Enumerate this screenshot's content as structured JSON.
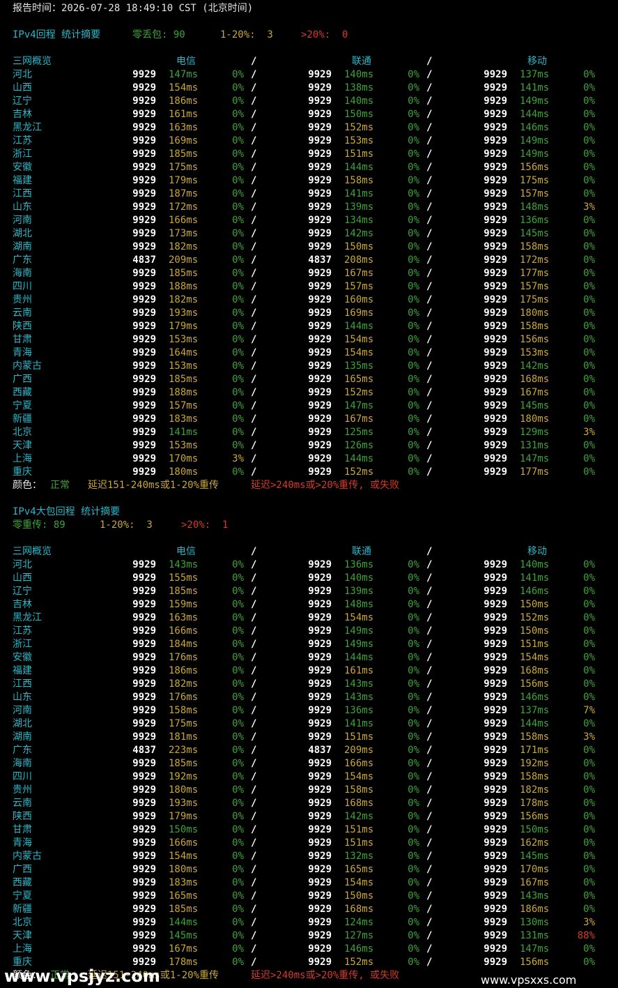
{
  "header": {
    "report_time": "报告时间：2026-07-28 18:49:10 CST (北京时间)"
  },
  "legend": {
    "label": "颜色：",
    "normal": "正常",
    "warn": "延迟151-240ms或1-20%重传",
    "bad": "延迟>240ms或>20%重传, 或失败"
  },
  "colors": {
    "green": "#3fa23a",
    "yellow": "#c8a83a",
    "red": "#d43c2c",
    "cyan": "#2ab7c9"
  },
  "columns": {
    "overview": "三网概览",
    "telecom": "电信",
    "unicom": "联通",
    "mobile": "移动",
    "sep": "/"
  },
  "sections": [
    {
      "title": "IPv4回程 统计摘要",
      "summary": [
        {
          "text": "零丢包: 90",
          "cls": "g"
        },
        {
          "text": "1-20%:  3",
          "cls": "y"
        },
        {
          "text": ">20%:  0",
          "cls": "r"
        }
      ],
      "rows": [
        [
          "河北",
          "9929",
          "147ms",
          "g",
          "0%",
          "g",
          "9929",
          "140ms",
          "g",
          "0%",
          "g",
          "9929",
          "137ms",
          "g",
          "0%",
          "g"
        ],
        [
          "山西",
          "9929",
          "154ms",
          "y",
          "0%",
          "g",
          "9929",
          "138ms",
          "g",
          "0%",
          "g",
          "9929",
          "141ms",
          "g",
          "0%",
          "g"
        ],
        [
          "辽宁",
          "9929",
          "186ms",
          "y",
          "0%",
          "g",
          "9929",
          "140ms",
          "g",
          "0%",
          "g",
          "9929",
          "149ms",
          "g",
          "0%",
          "g"
        ],
        [
          "吉林",
          "9929",
          "161ms",
          "y",
          "0%",
          "g",
          "9929",
          "150ms",
          "g",
          "0%",
          "g",
          "9929",
          "144ms",
          "g",
          "0%",
          "g"
        ],
        [
          "黑龙江",
          "9929",
          "163ms",
          "y",
          "0%",
          "g",
          "9929",
          "152ms",
          "y",
          "0%",
          "g",
          "9929",
          "146ms",
          "g",
          "0%",
          "g"
        ],
        [
          "江苏",
          "9929",
          "169ms",
          "y",
          "0%",
          "g",
          "9929",
          "153ms",
          "y",
          "0%",
          "g",
          "9929",
          "149ms",
          "g",
          "0%",
          "g"
        ],
        [
          "浙江",
          "9929",
          "185ms",
          "y",
          "0%",
          "g",
          "9929",
          "151ms",
          "y",
          "0%",
          "g",
          "9929",
          "149ms",
          "g",
          "0%",
          "g"
        ],
        [
          "安徽",
          "9929",
          "175ms",
          "y",
          "0%",
          "g",
          "9929",
          "144ms",
          "g",
          "0%",
          "g",
          "9929",
          "156ms",
          "y",
          "0%",
          "g"
        ],
        [
          "福建",
          "9929",
          "179ms",
          "y",
          "0%",
          "g",
          "9929",
          "158ms",
          "y",
          "0%",
          "g",
          "9929",
          "175ms",
          "y",
          "0%",
          "g"
        ],
        [
          "江西",
          "9929",
          "187ms",
          "y",
          "0%",
          "g",
          "9929",
          "141ms",
          "g",
          "0%",
          "g",
          "9929",
          "157ms",
          "y",
          "0%",
          "g"
        ],
        [
          "山东",
          "9929",
          "172ms",
          "y",
          "0%",
          "g",
          "9929",
          "139ms",
          "g",
          "0%",
          "g",
          "9929",
          "148ms",
          "g",
          "3%",
          "y"
        ],
        [
          "河南",
          "9929",
          "166ms",
          "y",
          "0%",
          "g",
          "9929",
          "134ms",
          "g",
          "0%",
          "g",
          "9929",
          "136ms",
          "g",
          "0%",
          "g"
        ],
        [
          "湖北",
          "9929",
          "173ms",
          "y",
          "0%",
          "g",
          "9929",
          "142ms",
          "g",
          "0%",
          "g",
          "9929",
          "145ms",
          "g",
          "0%",
          "g"
        ],
        [
          "湖南",
          "9929",
          "182ms",
          "y",
          "0%",
          "g",
          "9929",
          "150ms",
          "y",
          "0%",
          "g",
          "9929",
          "158ms",
          "y",
          "0%",
          "g"
        ],
        [
          "广东",
          "4837",
          "209ms",
          "y",
          "0%",
          "g",
          "4837",
          "208ms",
          "y",
          "0%",
          "g",
          "9929",
          "172ms",
          "y",
          "0%",
          "g"
        ],
        [
          "海南",
          "9929",
          "185ms",
          "y",
          "0%",
          "g",
          "9929",
          "167ms",
          "y",
          "0%",
          "g",
          "9929",
          "177ms",
          "y",
          "0%",
          "g"
        ],
        [
          "四川",
          "9929",
          "188ms",
          "y",
          "0%",
          "g",
          "9929",
          "157ms",
          "y",
          "0%",
          "g",
          "9929",
          "157ms",
          "y",
          "0%",
          "g"
        ],
        [
          "贵州",
          "9929",
          "182ms",
          "y",
          "0%",
          "g",
          "9929",
          "160ms",
          "y",
          "0%",
          "g",
          "9929",
          "175ms",
          "y",
          "0%",
          "g"
        ],
        [
          "云南",
          "9929",
          "193ms",
          "y",
          "0%",
          "g",
          "9929",
          "169ms",
          "y",
          "0%",
          "g",
          "9929",
          "180ms",
          "y",
          "0%",
          "g"
        ],
        [
          "陕西",
          "9929",
          "179ms",
          "y",
          "0%",
          "g",
          "9929",
          "144ms",
          "g",
          "0%",
          "g",
          "9929",
          "158ms",
          "y",
          "0%",
          "g"
        ],
        [
          "甘肃",
          "9929",
          "153ms",
          "y",
          "0%",
          "g",
          "9929",
          "154ms",
          "y",
          "0%",
          "g",
          "9929",
          "156ms",
          "y",
          "0%",
          "g"
        ],
        [
          "青海",
          "9929",
          "164ms",
          "y",
          "0%",
          "g",
          "9929",
          "154ms",
          "y",
          "0%",
          "g",
          "9929",
          "153ms",
          "y",
          "0%",
          "g"
        ],
        [
          "内蒙古",
          "9929",
          "153ms",
          "y",
          "0%",
          "g",
          "9929",
          "135ms",
          "g",
          "0%",
          "g",
          "9929",
          "142ms",
          "g",
          "0%",
          "g"
        ],
        [
          "广西",
          "9929",
          "185ms",
          "y",
          "0%",
          "g",
          "9929",
          "165ms",
          "y",
          "0%",
          "g",
          "9929",
          "168ms",
          "y",
          "0%",
          "g"
        ],
        [
          "西藏",
          "9929",
          "188ms",
          "y",
          "0%",
          "g",
          "9929",
          "152ms",
          "y",
          "0%",
          "g",
          "9929",
          "167ms",
          "y",
          "0%",
          "g"
        ],
        [
          "宁夏",
          "9929",
          "157ms",
          "y",
          "0%",
          "g",
          "9929",
          "147ms",
          "g",
          "0%",
          "g",
          "9929",
          "145ms",
          "g",
          "0%",
          "g"
        ],
        [
          "新疆",
          "9929",
          "183ms",
          "y",
          "0%",
          "g",
          "9929",
          "167ms",
          "y",
          "0%",
          "g",
          "9929",
          "180ms",
          "y",
          "0%",
          "g"
        ],
        [
          "北京",
          "9929",
          "141ms",
          "g",
          "0%",
          "g",
          "9929",
          "125ms",
          "g",
          "0%",
          "g",
          "9929",
          "129ms",
          "g",
          "3%",
          "y"
        ],
        [
          "天津",
          "9929",
          "153ms",
          "y",
          "0%",
          "g",
          "9929",
          "126ms",
          "g",
          "0%",
          "g",
          "9929",
          "131ms",
          "g",
          "0%",
          "g"
        ],
        [
          "上海",
          "9929",
          "170ms",
          "y",
          "3%",
          "y",
          "9929",
          "144ms",
          "g",
          "0%",
          "g",
          "9929",
          "147ms",
          "g",
          "0%",
          "g"
        ],
        [
          "重庆",
          "9929",
          "180ms",
          "y",
          "0%",
          "g",
          "9929",
          "152ms",
          "y",
          "0%",
          "g",
          "9929",
          "177ms",
          "y",
          "0%",
          "g"
        ]
      ]
    },
    {
      "title": "IPv4大包回程 统计摘要",
      "summary": [
        {
          "text": "零重传: 89",
          "cls": "g"
        },
        {
          "text": "1-20%:  3",
          "cls": "y"
        },
        {
          "text": ">20%:  1",
          "cls": "r"
        }
      ],
      "rows": [
        [
          "河北",
          "9929",
          "143ms",
          "g",
          "0%",
          "g",
          "9929",
          "136ms",
          "g",
          "0%",
          "g",
          "9929",
          "140ms",
          "g",
          "0%",
          "g"
        ],
        [
          "山西",
          "9929",
          "155ms",
          "y",
          "0%",
          "g",
          "9929",
          "140ms",
          "g",
          "0%",
          "g",
          "9929",
          "141ms",
          "g",
          "0%",
          "g"
        ],
        [
          "辽宁",
          "9929",
          "185ms",
          "y",
          "0%",
          "g",
          "9929",
          "139ms",
          "g",
          "0%",
          "g",
          "9929",
          "146ms",
          "g",
          "0%",
          "g"
        ],
        [
          "吉林",
          "9929",
          "159ms",
          "y",
          "0%",
          "g",
          "9929",
          "148ms",
          "g",
          "0%",
          "g",
          "9929",
          "150ms",
          "y",
          "0%",
          "g"
        ],
        [
          "黑龙江",
          "9929",
          "163ms",
          "y",
          "0%",
          "g",
          "9929",
          "154ms",
          "y",
          "0%",
          "g",
          "9929",
          "152ms",
          "y",
          "0%",
          "g"
        ],
        [
          "江苏",
          "9929",
          "166ms",
          "y",
          "0%",
          "g",
          "9929",
          "149ms",
          "g",
          "0%",
          "g",
          "9929",
          "150ms",
          "y",
          "0%",
          "g"
        ],
        [
          "浙江",
          "9929",
          "184ms",
          "y",
          "0%",
          "g",
          "9929",
          "149ms",
          "g",
          "0%",
          "g",
          "9929",
          "151ms",
          "y",
          "0%",
          "g"
        ],
        [
          "安徽",
          "9929",
          "176ms",
          "y",
          "0%",
          "g",
          "9929",
          "144ms",
          "g",
          "0%",
          "g",
          "9929",
          "154ms",
          "y",
          "0%",
          "g"
        ],
        [
          "福建",
          "9929",
          "186ms",
          "y",
          "0%",
          "g",
          "9929",
          "161ms",
          "y",
          "0%",
          "g",
          "9929",
          "168ms",
          "y",
          "0%",
          "g"
        ],
        [
          "江西",
          "9929",
          "182ms",
          "y",
          "0%",
          "g",
          "9929",
          "143ms",
          "g",
          "0%",
          "g",
          "9929",
          "156ms",
          "y",
          "0%",
          "g"
        ],
        [
          "山东",
          "9929",
          "176ms",
          "y",
          "0%",
          "g",
          "9929",
          "143ms",
          "g",
          "0%",
          "g",
          "9929",
          "146ms",
          "g",
          "0%",
          "g"
        ],
        [
          "河南",
          "9929",
          "158ms",
          "y",
          "0%",
          "g",
          "9929",
          "136ms",
          "g",
          "0%",
          "g",
          "9929",
          "137ms",
          "g",
          "7%",
          "y"
        ],
        [
          "湖北",
          "9929",
          "175ms",
          "y",
          "0%",
          "g",
          "9929",
          "141ms",
          "g",
          "0%",
          "g",
          "9929",
          "144ms",
          "g",
          "0%",
          "g"
        ],
        [
          "湖南",
          "9929",
          "181ms",
          "y",
          "0%",
          "g",
          "9929",
          "151ms",
          "y",
          "0%",
          "g",
          "9929",
          "158ms",
          "y",
          "3%",
          "y"
        ],
        [
          "广东",
          "4837",
          "223ms",
          "y",
          "0%",
          "g",
          "4837",
          "209ms",
          "y",
          "0%",
          "g",
          "9929",
          "171ms",
          "y",
          "0%",
          "g"
        ],
        [
          "海南",
          "9929",
          "185ms",
          "y",
          "0%",
          "g",
          "9929",
          "166ms",
          "y",
          "0%",
          "g",
          "9929",
          "192ms",
          "y",
          "0%",
          "g"
        ],
        [
          "四川",
          "9929",
          "192ms",
          "y",
          "0%",
          "g",
          "9929",
          "154ms",
          "y",
          "0%",
          "g",
          "9929",
          "158ms",
          "y",
          "0%",
          "g"
        ],
        [
          "贵州",
          "9929",
          "180ms",
          "y",
          "0%",
          "g",
          "9929",
          "158ms",
          "y",
          "0%",
          "g",
          "9929",
          "182ms",
          "y",
          "0%",
          "g"
        ],
        [
          "云南",
          "9929",
          "193ms",
          "y",
          "0%",
          "g",
          "9929",
          "168ms",
          "y",
          "0%",
          "g",
          "9929",
          "178ms",
          "y",
          "0%",
          "g"
        ],
        [
          "陕西",
          "9929",
          "179ms",
          "y",
          "0%",
          "g",
          "9929",
          "142ms",
          "g",
          "0%",
          "g",
          "9929",
          "156ms",
          "y",
          "0%",
          "g"
        ],
        [
          "甘肃",
          "9929",
          "150ms",
          "g",
          "0%",
          "g",
          "9929",
          "151ms",
          "y",
          "0%",
          "g",
          "9929",
          "150ms",
          "g",
          "0%",
          "g"
        ],
        [
          "青海",
          "9929",
          "166ms",
          "y",
          "0%",
          "g",
          "9929",
          "151ms",
          "y",
          "0%",
          "g",
          "9929",
          "162ms",
          "y",
          "0%",
          "g"
        ],
        [
          "内蒙古",
          "9929",
          "154ms",
          "y",
          "0%",
          "g",
          "9929",
          "132ms",
          "g",
          "0%",
          "g",
          "9929",
          "145ms",
          "g",
          "0%",
          "g"
        ],
        [
          "广西",
          "9929",
          "180ms",
          "y",
          "0%",
          "g",
          "9929",
          "165ms",
          "y",
          "0%",
          "g",
          "9929",
          "170ms",
          "y",
          "0%",
          "g"
        ],
        [
          "西藏",
          "9929",
          "183ms",
          "y",
          "0%",
          "g",
          "9929",
          "154ms",
          "y",
          "0%",
          "g",
          "9929",
          "167ms",
          "y",
          "0%",
          "g"
        ],
        [
          "宁夏",
          "9929",
          "165ms",
          "y",
          "0%",
          "g",
          "9929",
          "150ms",
          "y",
          "0%",
          "g",
          "9929",
          "143ms",
          "g",
          "0%",
          "g"
        ],
        [
          "新疆",
          "9929",
          "185ms",
          "y",
          "0%",
          "g",
          "9929",
          "168ms",
          "y",
          "0%",
          "g",
          "9929",
          "186ms",
          "y",
          "0%",
          "g"
        ],
        [
          "北京",
          "9929",
          "144ms",
          "g",
          "0%",
          "g",
          "9929",
          "124ms",
          "g",
          "0%",
          "g",
          "9929",
          "130ms",
          "g",
          "3%",
          "y"
        ],
        [
          "天津",
          "9929",
          "145ms",
          "g",
          "0%",
          "g",
          "9929",
          "127ms",
          "g",
          "0%",
          "g",
          "9929",
          "131ms",
          "g",
          "88%",
          "r"
        ],
        [
          "上海",
          "9929",
          "167ms",
          "y",
          "0%",
          "g",
          "9929",
          "146ms",
          "g",
          "0%",
          "g",
          "9929",
          "147ms",
          "g",
          "0%",
          "g"
        ],
        [
          "重庆",
          "9929",
          "178ms",
          "y",
          "0%",
          "g",
          "9929",
          "152ms",
          "y",
          "0%",
          "g",
          "9929",
          "156ms",
          "y",
          "0%",
          "g"
        ]
      ]
    }
  ],
  "watermarks": {
    "left": "www.vpsjyz.com",
    "right": "www.vpsxxs.com"
  }
}
